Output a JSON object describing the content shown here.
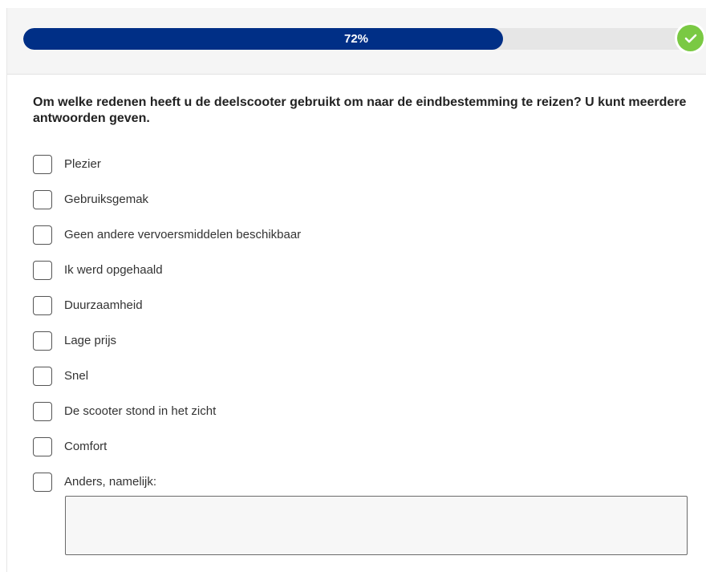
{
  "progress": {
    "label": "72%",
    "fraction": 0.72,
    "complete_icon": "check-icon",
    "fill_color": "#002f86",
    "complete_color": "#7ac943"
  },
  "question": {
    "text": "Om welke redenen heeft u de deelscooter gebruikt om naar de eindbestemming te reizen? U kunt meerdere antwoorden geven."
  },
  "options": [
    {
      "label": "Plezier"
    },
    {
      "label": "Gebruiksgemak"
    },
    {
      "label": "Geen andere vervoersmiddelen beschikbaar"
    },
    {
      "label": "Ik werd opgehaald"
    },
    {
      "label": "Duurzaamheid"
    },
    {
      "label": "Lage prijs"
    },
    {
      "label": "Snel"
    },
    {
      "label": "De scooter stond in het zicht"
    },
    {
      "label": "Comfort"
    },
    {
      "label": "Anders, namelijk:"
    }
  ],
  "other_input": {
    "value": "",
    "placeholder": ""
  }
}
